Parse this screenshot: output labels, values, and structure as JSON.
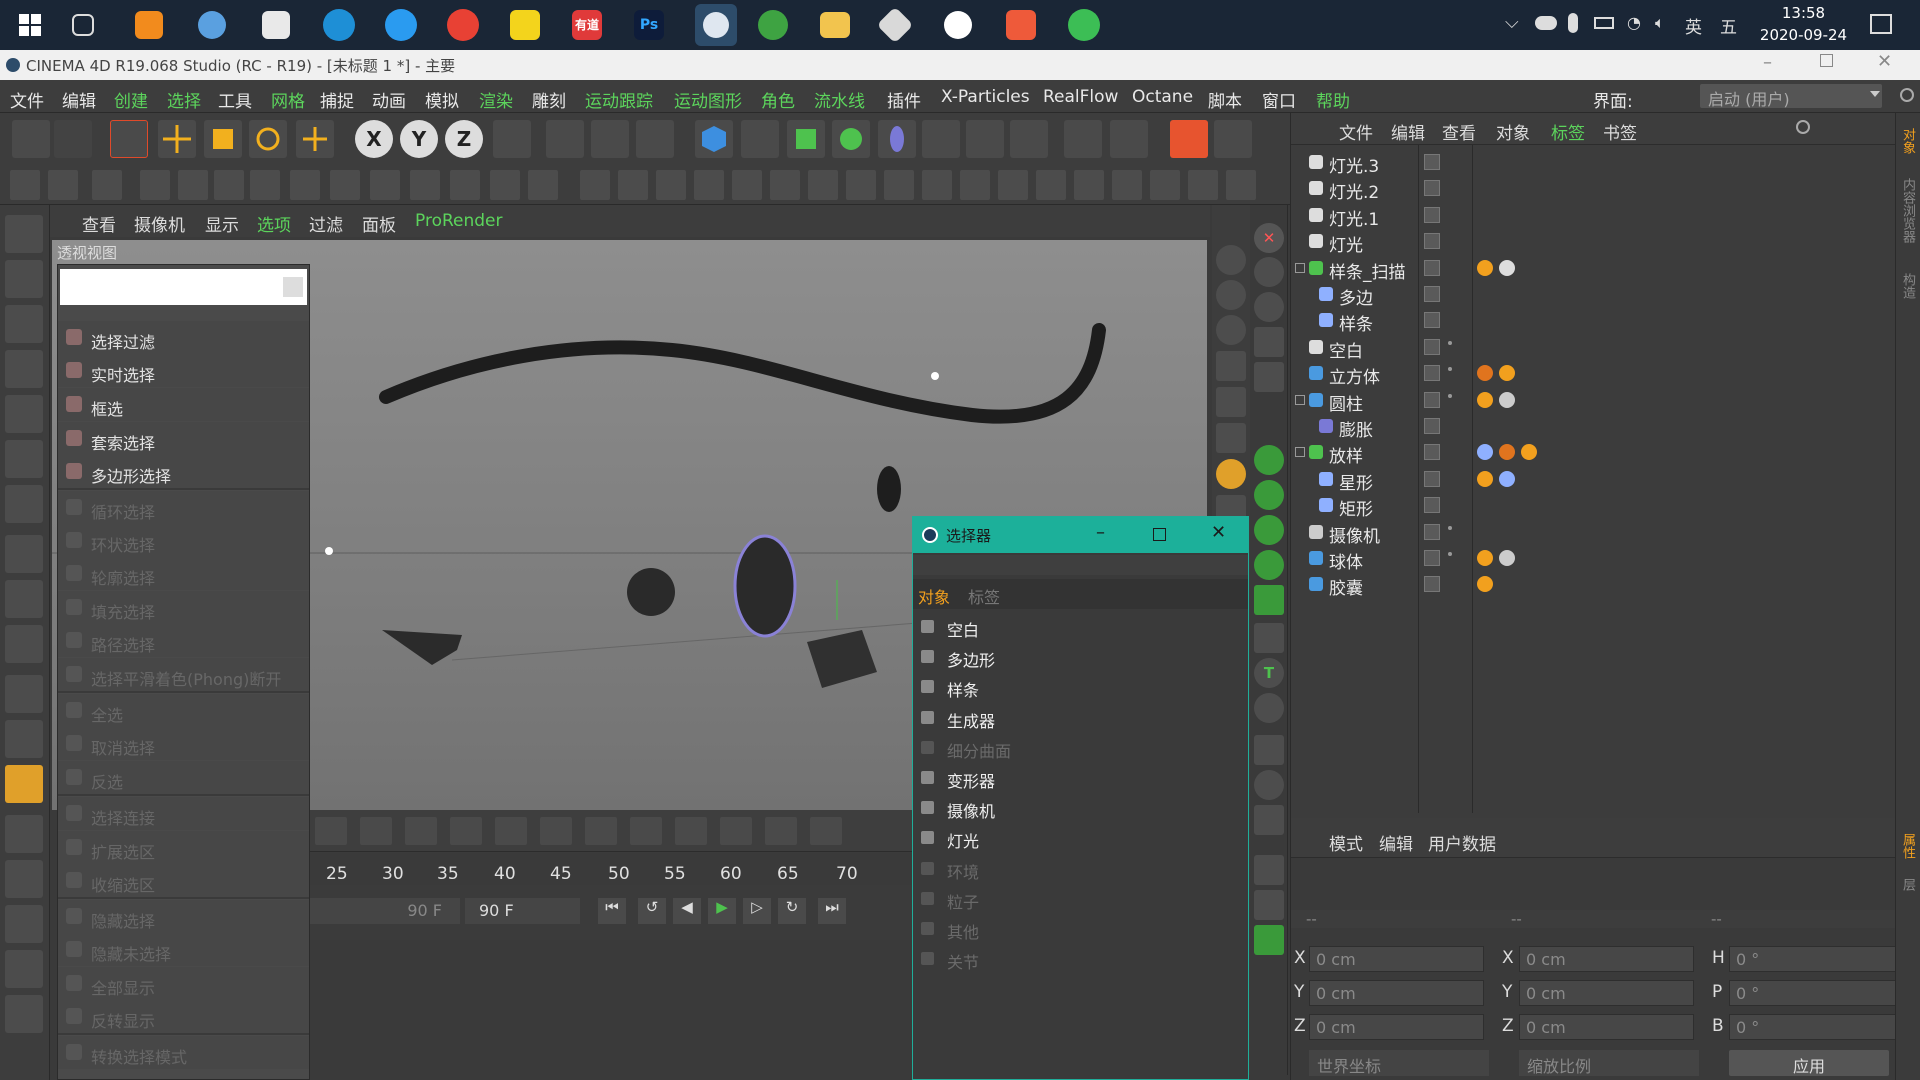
{
  "taskbar": {
    "icons": [
      "start-icon",
      "task-view-icon",
      "sublime-icon",
      "user-icon",
      "notes-icon",
      "edge-icon",
      "qq-browser-icon",
      "chrome-icon",
      "player-icon",
      "youdao-icon",
      "photoshop-icon",
      "cinema4d-icon",
      "earth-icon",
      "file-explorer-icon",
      "app-icon",
      "map-pin-icon",
      "c-app-icon",
      "wechat-icon"
    ],
    "ps_label": "Ps",
    "youdao_label": "有道",
    "ime": "英",
    "ime2": "五",
    "time": "13:58",
    "date": "2020-09-24"
  },
  "window": {
    "title": "CINEMA 4D R19.068 Studio (RC - R19) - [未标题 1 *] - 主要"
  },
  "menu": [
    "文件",
    "编辑",
    "创建",
    "选择",
    "工具",
    "网格",
    "捕捉",
    "动画",
    "模拟",
    "渲染",
    "雕刻",
    "运动跟踪",
    "运动图形",
    "角色",
    "流水线",
    "插件",
    "X-Particles",
    "RealFlow",
    "Octane",
    "脚本",
    "窗口",
    "帮助"
  ],
  "interface": {
    "label": "界面:",
    "value": "启动 (用户)"
  },
  "viewport": {
    "menu": [
      "查看",
      "摄像机",
      "显示",
      "选项",
      "过滤",
      "面板",
      "ProRender"
    ],
    "label": "透视视图"
  },
  "context_menu": {
    "items": [
      {
        "label": "选择过滤",
        "enabled": true
      },
      {
        "label": "实时选择",
        "enabled": true
      },
      {
        "label": "框选",
        "enabled": true
      },
      {
        "label": "套索选择",
        "enabled": true
      },
      {
        "label": "多边形选择",
        "enabled": true
      },
      {
        "label": "循环选择",
        "enabled": false
      },
      {
        "label": "环状选择",
        "enabled": false
      },
      {
        "label": "轮廓选择",
        "enabled": false
      },
      {
        "label": "填充选择",
        "enabled": false
      },
      {
        "label": "路径选择",
        "enabled": false
      },
      {
        "label": "选择平滑着色(Phong)断开",
        "enabled": false
      },
      {
        "label": "全选",
        "enabled": false
      },
      {
        "label": "取消选择",
        "enabled": false
      },
      {
        "label": "反选",
        "enabled": false
      },
      {
        "label": "选择连接",
        "enabled": false
      },
      {
        "label": "扩展选区",
        "enabled": false
      },
      {
        "label": "收缩选区",
        "enabled": false
      },
      {
        "label": "隐藏选择",
        "enabled": false
      },
      {
        "label": "隐藏未选择",
        "enabled": false
      },
      {
        "label": "全部显示",
        "enabled": false
      },
      {
        "label": "反转显示",
        "enabled": false
      },
      {
        "label": "转换选择模式",
        "enabled": false
      }
    ]
  },
  "selector": {
    "title": "选择器",
    "tabs": [
      "对象",
      "标签"
    ],
    "options": [
      {
        "label": "空白",
        "enabled": true
      },
      {
        "label": "多边形",
        "enabled": true
      },
      {
        "label": "样条",
        "enabled": true
      },
      {
        "label": "生成器",
        "enabled": true
      },
      {
        "label": "细分曲面",
        "enabled": false
      },
      {
        "label": "变形器",
        "enabled": true
      },
      {
        "label": "摄像机",
        "enabled": true
      },
      {
        "label": "灯光",
        "enabled": true
      },
      {
        "label": "环境",
        "enabled": false
      },
      {
        "label": "粒子",
        "enabled": false
      },
      {
        "label": "其他",
        "enabled": false
      },
      {
        "label": "关节",
        "enabled": false
      }
    ]
  },
  "timeline": {
    "ticks": [
      "25",
      "30",
      "35",
      "40",
      "45",
      "50",
      "55",
      "60",
      "65",
      "70"
    ],
    "end_frame_a": "90 F",
    "end_frame_b": "90 F"
  },
  "object_manager": {
    "menu": [
      "文件",
      "编辑",
      "查看",
      "对象",
      "标签",
      "书签"
    ],
    "objects": [
      {
        "name": "灯光.3",
        "indent": 0,
        "icon": "light-icon",
        "check": true
      },
      {
        "name": "灯光.2",
        "indent": 0,
        "icon": "light-icon",
        "check": true
      },
      {
        "name": "灯光.1",
        "indent": 0,
        "icon": "light-icon",
        "check": true
      },
      {
        "name": "灯光",
        "indent": 0,
        "icon": "light-icon",
        "check": true
      },
      {
        "name": "样条_扫描",
        "indent": 0,
        "icon": "sweep-icon",
        "check": true
      },
      {
        "name": "多边",
        "indent": 1,
        "icon": "polygon-spline-icon",
        "check": true
      },
      {
        "name": "样条",
        "indent": 1,
        "icon": "spline-icon",
        "check": true
      },
      {
        "name": "空白",
        "indent": 0,
        "icon": "null-icon",
        "check": false
      },
      {
        "name": "立方体",
        "indent": 0,
        "icon": "cube-icon",
        "check": false
      },
      {
        "name": "圆柱",
        "indent": 0,
        "icon": "cylinder-icon",
        "check": false
      },
      {
        "name": "膨胀",
        "indent": 1,
        "icon": "bulge-icon",
        "check": true
      },
      {
        "name": "放样",
        "indent": 0,
        "icon": "loft-icon",
        "check": true
      },
      {
        "name": "星形",
        "indent": 1,
        "icon": "star-icon",
        "check": true
      },
      {
        "name": "矩形",
        "indent": 1,
        "icon": "rectangle-icon",
        "check": true
      },
      {
        "name": "摄像机",
        "indent": 0,
        "icon": "camera-icon",
        "check": false
      },
      {
        "name": "球体",
        "indent": 0,
        "icon": "sphere-icon",
        "check": false
      },
      {
        "name": "胶囊",
        "indent": 0,
        "icon": "capsule-icon",
        "check": true
      }
    ]
  },
  "attributes": {
    "menu": [
      "模式",
      "编辑",
      "用户数据"
    ],
    "col_headers": [
      "--",
      "--",
      "--"
    ],
    "rows": [
      {
        "l1": "X",
        "v1": "0 cm",
        "l2": "X",
        "v2": "0 cm",
        "l3": "H",
        "v3": "0 °"
      },
      {
        "l1": "Y",
        "v1": "0 cm",
        "l2": "Y",
        "v2": "0 cm",
        "l3": "P",
        "v3": "0 °"
      },
      {
        "l1": "Z",
        "v1": "0 cm",
        "l2": "Z",
        "v2": "0 cm",
        "l3": "B",
        "v3": "0 °"
      }
    ],
    "world_coord": "世界坐标",
    "scale": "缩放比例",
    "apply": "应用"
  },
  "right_strip": [
    "对象",
    "内容浏览器",
    "构造",
    "属性",
    "层"
  ]
}
